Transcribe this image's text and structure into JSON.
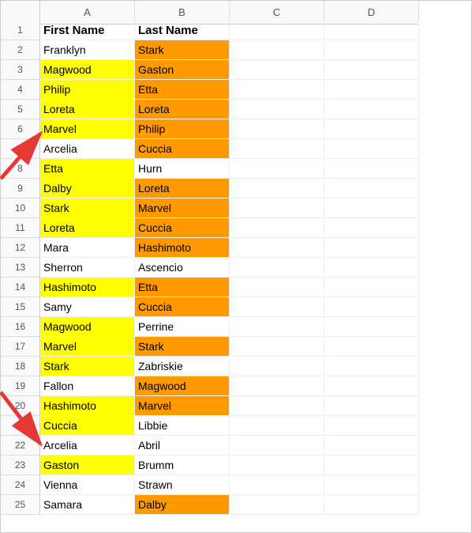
{
  "columns": [
    "A",
    "B",
    "C",
    "D"
  ],
  "row_headers": [
    "1",
    "2",
    "3",
    "4",
    "5",
    "6",
    "7",
    "8",
    "9",
    "10",
    "11",
    "12",
    "13",
    "14",
    "15",
    "16",
    "17",
    "18",
    "19",
    "20",
    "21",
    "22",
    "23",
    "24",
    "25"
  ],
  "header_row": {
    "A": "First Name",
    "B": "Last Name"
  },
  "colors": {
    "yellow": "#ffff00",
    "orange": "#ff9900"
  },
  "rows": [
    {
      "A": {
        "value": "Franklyn",
        "hl": null
      },
      "B": {
        "value": "Stark",
        "hl": "orange"
      }
    },
    {
      "A": {
        "value": "Magwood",
        "hl": "yellow"
      },
      "B": {
        "value": "Gaston",
        "hl": "orange"
      }
    },
    {
      "A": {
        "value": "Philip",
        "hl": "yellow"
      },
      "B": {
        "value": "Etta",
        "hl": "orange"
      }
    },
    {
      "A": {
        "value": "Loreta",
        "hl": "yellow"
      },
      "B": {
        "value": "Loreta",
        "hl": "orange"
      }
    },
    {
      "A": {
        "value": "Marvel",
        "hl": "yellow"
      },
      "B": {
        "value": "Philip",
        "hl": "orange"
      }
    },
    {
      "A": {
        "value": "Arcelia",
        "hl": null
      },
      "B": {
        "value": "Cuccia",
        "hl": "orange"
      }
    },
    {
      "A": {
        "value": "Etta",
        "hl": "yellow"
      },
      "B": {
        "value": "Hurn",
        "hl": null
      }
    },
    {
      "A": {
        "value": "Dalby",
        "hl": "yellow"
      },
      "B": {
        "value": "Loreta",
        "hl": "orange"
      }
    },
    {
      "A": {
        "value": "Stark",
        "hl": "yellow"
      },
      "B": {
        "value": "Marvel",
        "hl": "orange"
      }
    },
    {
      "A": {
        "value": "Loreta",
        "hl": "yellow"
      },
      "B": {
        "value": "Cuccia",
        "hl": "orange"
      }
    },
    {
      "A": {
        "value": "Mara",
        "hl": null
      },
      "B": {
        "value": "Hashimoto",
        "hl": "orange"
      }
    },
    {
      "A": {
        "value": "Sherron",
        "hl": null
      },
      "B": {
        "value": "Ascencio",
        "hl": null
      }
    },
    {
      "A": {
        "value": "Hashimoto",
        "hl": "yellow"
      },
      "B": {
        "value": "Etta",
        "hl": "orange"
      }
    },
    {
      "A": {
        "value": "Samy",
        "hl": null
      },
      "B": {
        "value": "Cuccia",
        "hl": "orange"
      }
    },
    {
      "A": {
        "value": "Magwood",
        "hl": "yellow"
      },
      "B": {
        "value": "Perrine",
        "hl": null
      }
    },
    {
      "A": {
        "value": "Marvel",
        "hl": "yellow"
      },
      "B": {
        "value": "Stark",
        "hl": "orange"
      }
    },
    {
      "A": {
        "value": "Stark",
        "hl": "yellow"
      },
      "B": {
        "value": "Zabriskie",
        "hl": null
      }
    },
    {
      "A": {
        "value": "Fallon",
        "hl": null
      },
      "B": {
        "value": "Magwood",
        "hl": "orange"
      }
    },
    {
      "A": {
        "value": "Hashimoto",
        "hl": "yellow"
      },
      "B": {
        "value": "Marvel",
        "hl": "orange"
      }
    },
    {
      "A": {
        "value": "Cuccia",
        "hl": "yellow"
      },
      "B": {
        "value": "Libbie",
        "hl": null
      }
    },
    {
      "A": {
        "value": "Arcelia",
        "hl": null
      },
      "B": {
        "value": "Abril",
        "hl": null
      }
    },
    {
      "A": {
        "value": "Gaston",
        "hl": "yellow"
      },
      "B": {
        "value": "Brumm",
        "hl": null
      }
    },
    {
      "A": {
        "value": "Vienna",
        "hl": null
      },
      "B": {
        "value": "Strawn",
        "hl": null
      }
    },
    {
      "A": {
        "value": "Samara",
        "hl": null
      },
      "B": {
        "value": "Dalby",
        "hl": "orange"
      }
    }
  ]
}
